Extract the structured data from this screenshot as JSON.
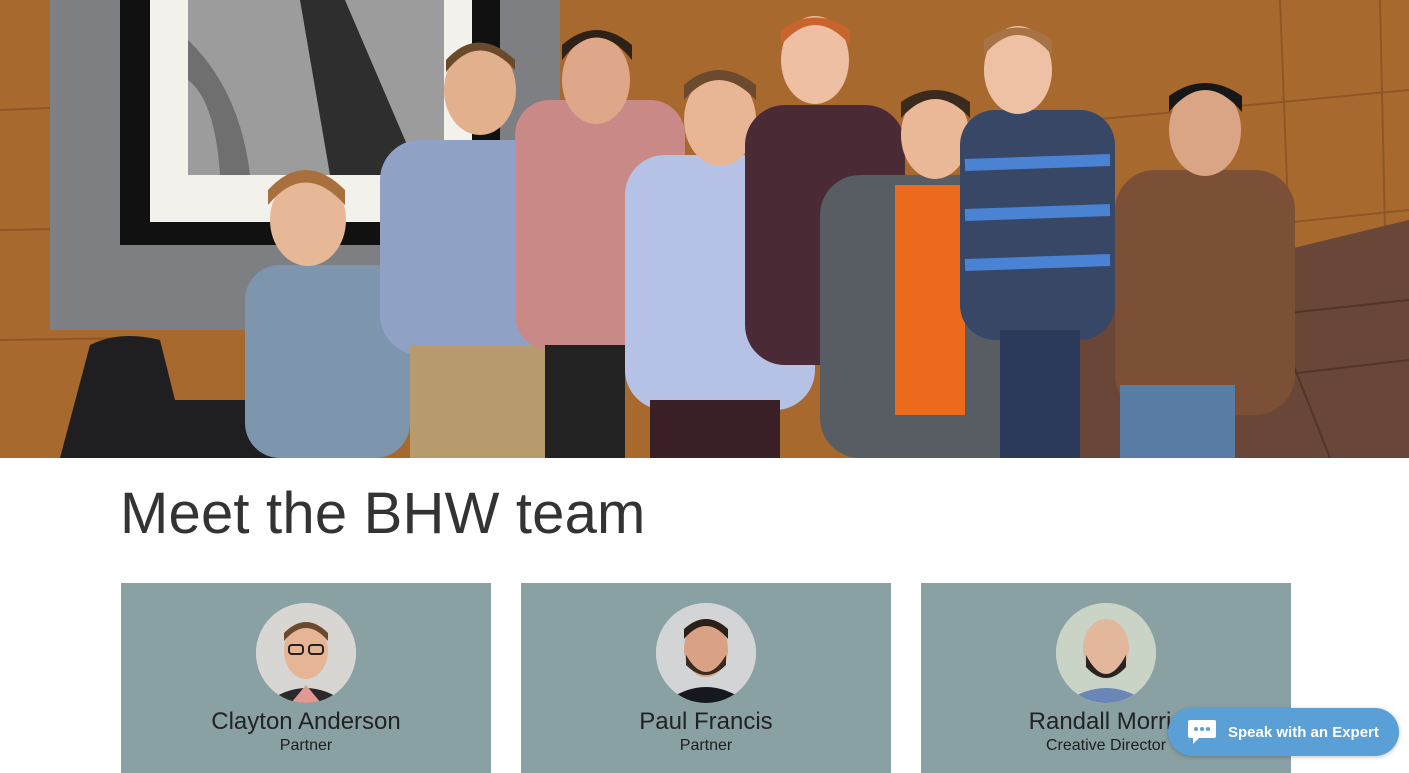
{
  "hero": {
    "photo_icon": "team-group-photo"
  },
  "section": {
    "title": "Meet the BHW team"
  },
  "team": [
    {
      "name": "Clayton Anderson",
      "role": "Partner",
      "avatar_icon": "person-glasses-avatar"
    },
    {
      "name": "Paul Francis",
      "role": "Partner",
      "avatar_icon": "person-beard-avatar"
    },
    {
      "name": "Randall Morris",
      "role": "Creative Director",
      "avatar_icon": "person-bald-beard-avatar"
    }
  ],
  "chat": {
    "label": "Speak with an Expert",
    "icon": "chat-bubble-icon"
  },
  "colors": {
    "card_background": "#8aa1a4",
    "chat_button": "#5a9fd6",
    "heading_text": "#333333"
  }
}
